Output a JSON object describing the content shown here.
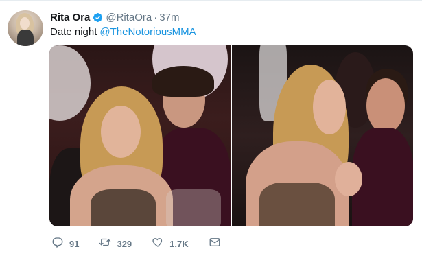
{
  "tweet": {
    "author_name": "Rita Ora",
    "author_handle": "@RitaOra",
    "separator": "·",
    "timestamp": "37m",
    "text": "Date night",
    "mention": "@TheNotoriousMMA"
  },
  "actions": {
    "replies": "91",
    "retweets": "329",
    "likes": "1.7K"
  },
  "colors": {
    "accent": "#1b95e0",
    "secondary_text": "#657786",
    "verified": "#1da1f2"
  }
}
